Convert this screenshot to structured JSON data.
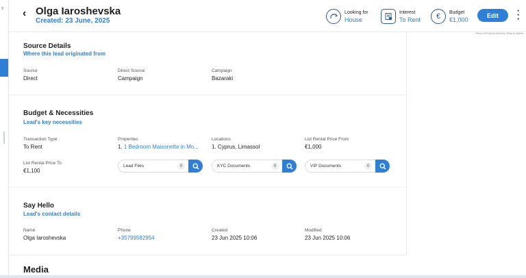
{
  "header": {
    "name": "Olga Iaroshevska",
    "created": "Created: 23 June, 2025",
    "looking_for_label": "Looking for",
    "looking_for_value": "House",
    "interest_label": "Interest",
    "interest_value": "To Rent",
    "budget_label": "Budget",
    "budget_value": "€1,000",
    "edit_label": "Edit",
    "right_note": "Press Ctrl/Cmd for New line, Enter to Submit"
  },
  "source": {
    "title": "Source Details",
    "subtitle": "Where this lead originated from",
    "fields": [
      {
        "label": "Source",
        "value": "Direct"
      },
      {
        "label": "Direct Source",
        "value": "Campaign"
      },
      {
        "label": "Campaign",
        "value": "Bazaraki"
      }
    ]
  },
  "budget": {
    "title": "Budget & Necessities",
    "subtitle": "Lead's key necessities",
    "fields": [
      {
        "label": "Transaction Type",
        "value": "To Rent"
      },
      {
        "label": "Properties",
        "value": "1. 1 Bedroom Maisonette in Mo..."
      },
      {
        "label": "Locations",
        "value": "1. Cyprus, Limassol"
      },
      {
        "label": "List Rental Price From",
        "value": "€1,000"
      },
      {
        "label": "List Rental Price To",
        "value": "€1,100"
      }
    ],
    "properties_prefix": "1. ",
    "properties_link": "1 Bedroom Maisonette in Mo...",
    "docs": [
      {
        "label": "Lead Files",
        "count": "0"
      },
      {
        "label": "KYC Documents",
        "count": "0"
      },
      {
        "label": "VIP Documents",
        "count": "0"
      }
    ]
  },
  "hello": {
    "title": "Say Hello",
    "subtitle": "Lead's contact details",
    "fields": [
      {
        "label": "Name",
        "value": "Olga Iaroshevska"
      },
      {
        "label": "Phone",
        "value": "+35799582954"
      },
      {
        "label": "Created",
        "value": "23 Jun 2025 10:06"
      },
      {
        "label": "Modified",
        "value": "23 Jun 2025 10:06"
      }
    ]
  },
  "media": {
    "title": "Media"
  },
  "colors": {
    "accent": "#2f7fd6",
    "icon": "#2a5a8a"
  },
  "icons": [
    "back-arrow-icon",
    "house-icon",
    "interest-icon",
    "euro-icon",
    "search-icon",
    "kebab-menu-icon"
  ]
}
